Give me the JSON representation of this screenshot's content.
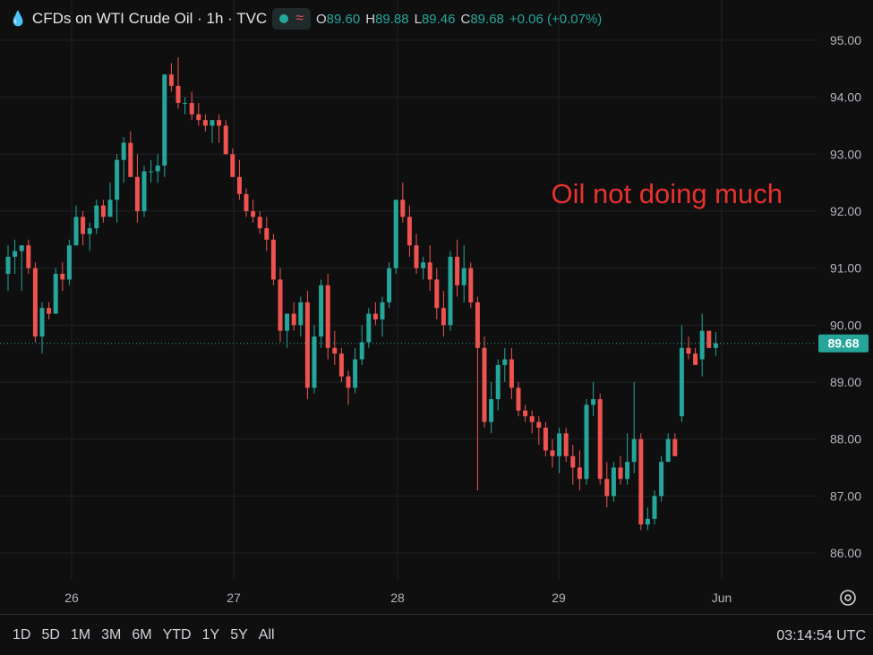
{
  "header": {
    "title": "CFDs on WTI Crude Oil · 1h · TVC",
    "ohlc": [
      {
        "k": "O",
        "v": "89.60"
      },
      {
        "k": "H",
        "v": "89.88"
      },
      {
        "k": "L",
        "v": "89.46"
      },
      {
        "k": "C",
        "v": "89.68"
      },
      {
        "k": "",
        "v": "+0.06 (+0.07%)"
      }
    ]
  },
  "range_buttons": [
    "1D",
    "5D",
    "1M",
    "3M",
    "6M",
    "YTD",
    "1Y",
    "5Y",
    "All"
  ],
  "clock": "03:14:54 UTC",
  "chart_data": {
    "type": "candlestick",
    "annotation": "Oil not doing much",
    "ylim": [
      85.6,
      95.3
    ],
    "y_ticks": [
      "95.00",
      "94.00",
      "93.00",
      "92.00",
      "91.00",
      "90.00",
      "89.00",
      "88.00",
      "87.00",
      "86.00"
    ],
    "x_ticks": [
      {
        "label": "26",
        "x": 3
      },
      {
        "label": "27",
        "x": 27
      },
      {
        "label": "28",
        "x": 51
      },
      {
        "label": "29",
        "x": 75
      },
      {
        "label": "Jun",
        "x": 99
      }
    ],
    "last_price": "89.68",
    "colors": {
      "up": "#26a69a",
      "down": "#ef5350"
    },
    "candles": [
      [
        90.9,
        91.4,
        90.6,
        91.2
      ],
      [
        91.2,
        91.5,
        90.9,
        91.3
      ],
      [
        91.3,
        91.4,
        90.6,
        91.4
      ],
      [
        91.4,
        91.5,
        90.9,
        91.0
      ],
      [
        91.0,
        91.1,
        89.7,
        89.8
      ],
      [
        89.8,
        90.4,
        89.5,
        90.3
      ],
      [
        90.3,
        90.4,
        90.1,
        90.2
      ],
      [
        90.2,
        91.0,
        90.2,
        90.9
      ],
      [
        90.9,
        91.1,
        90.6,
        90.8
      ],
      [
        90.8,
        91.5,
        90.7,
        91.4
      ],
      [
        91.4,
        92.1,
        91.4,
        91.9
      ],
      [
        91.9,
        92.0,
        91.4,
        91.6
      ],
      [
        91.6,
        91.8,
        91.3,
        91.7
      ],
      [
        91.7,
        92.2,
        91.6,
        92.1
      ],
      [
        92.1,
        92.2,
        91.8,
        91.9
      ],
      [
        91.9,
        92.5,
        91.9,
        92.2
      ],
      [
        92.2,
        93.0,
        91.8,
        92.9
      ],
      [
        92.9,
        93.3,
        92.5,
        93.2
      ],
      [
        93.2,
        93.4,
        92.6,
        92.6
      ],
      [
        92.6,
        93.0,
        91.8,
        92.0
      ],
      [
        92.0,
        92.8,
        91.9,
        92.7
      ],
      [
        92.7,
        92.9,
        92.5,
        92.7
      ],
      [
        92.7,
        93.0,
        92.5,
        92.8
      ],
      [
        92.8,
        94.4,
        92.6,
        94.4
      ],
      [
        94.4,
        94.6,
        94.1,
        94.2
      ],
      [
        94.2,
        94.7,
        93.8,
        93.9
      ],
      [
        93.9,
        94.0,
        93.7,
        93.9
      ],
      [
        93.9,
        94.1,
        93.6,
        93.7
      ],
      [
        93.7,
        93.9,
        93.5,
        93.6
      ],
      [
        93.6,
        93.7,
        93.4,
        93.5
      ],
      [
        93.5,
        93.6,
        93.2,
        93.6
      ],
      [
        93.6,
        93.7,
        93.2,
        93.5
      ],
      [
        93.5,
        93.6,
        93.0,
        93.0
      ],
      [
        93.0,
        93.1,
        92.6,
        92.6
      ],
      [
        92.6,
        92.9,
        92.2,
        92.3
      ],
      [
        92.3,
        92.4,
        91.9,
        92.0
      ],
      [
        92.0,
        92.2,
        91.8,
        91.9
      ],
      [
        91.9,
        92.0,
        91.6,
        91.7
      ],
      [
        91.7,
        91.9,
        91.3,
        91.5
      ],
      [
        91.5,
        91.6,
        90.7,
        90.8
      ],
      [
        90.8,
        91.0,
        89.7,
        89.9
      ],
      [
        89.9,
        90.2,
        89.6,
        90.2
      ],
      [
        90.2,
        90.4,
        89.9,
        90.0
      ],
      [
        90.0,
        90.5,
        89.8,
        90.4
      ],
      [
        90.4,
        90.6,
        88.7,
        88.9
      ],
      [
        88.9,
        90.0,
        88.8,
        89.8
      ],
      [
        89.8,
        90.8,
        89.6,
        90.7
      ],
      [
        90.7,
        90.9,
        89.4,
        89.6
      ],
      [
        89.6,
        89.9,
        89.3,
        89.5
      ],
      [
        89.5,
        89.6,
        89.0,
        89.1
      ],
      [
        89.1,
        89.2,
        88.6,
        88.9
      ],
      [
        88.9,
        89.6,
        88.8,
        89.4
      ],
      [
        89.4,
        90.0,
        89.3,
        89.7
      ],
      [
        89.7,
        90.3,
        89.6,
        90.2
      ],
      [
        90.2,
        90.4,
        90.0,
        90.1
      ],
      [
        90.1,
        90.5,
        89.8,
        90.4
      ],
      [
        90.4,
        91.1,
        90.3,
        91.0
      ],
      [
        91.0,
        92.2,
        90.9,
        92.2
      ],
      [
        92.2,
        92.5,
        91.8,
        91.9
      ],
      [
        91.9,
        92.1,
        91.2,
        91.4
      ],
      [
        91.4,
        91.6,
        90.9,
        91.0
      ],
      [
        91.0,
        91.2,
        90.8,
        91.1
      ],
      [
        91.1,
        91.4,
        90.6,
        90.8
      ],
      [
        90.8,
        91.0,
        90.1,
        90.3
      ],
      [
        90.3,
        90.6,
        89.8,
        90.0
      ],
      [
        90.0,
        91.3,
        89.9,
        91.2
      ],
      [
        91.2,
        91.5,
        90.5,
        90.7
      ],
      [
        90.7,
        91.4,
        90.4,
        91.0
      ],
      [
        91.0,
        91.1,
        90.3,
        90.4
      ],
      [
        90.4,
        90.5,
        87.1,
        89.6
      ],
      [
        89.6,
        89.8,
        88.2,
        88.3
      ],
      [
        88.3,
        89.0,
        88.1,
        88.7
      ],
      [
        88.7,
        89.4,
        88.5,
        89.3
      ],
      [
        89.3,
        89.6,
        89.0,
        89.4
      ],
      [
        89.4,
        89.6,
        88.7,
        88.9
      ],
      [
        88.9,
        89.0,
        88.4,
        88.5
      ],
      [
        88.5,
        88.6,
        88.3,
        88.4
      ],
      [
        88.4,
        88.5,
        88.1,
        88.3
      ],
      [
        88.3,
        88.4,
        87.9,
        88.2
      ],
      [
        88.2,
        88.3,
        87.7,
        87.8
      ],
      [
        87.8,
        88.0,
        87.5,
        87.7
      ],
      [
        87.7,
        88.2,
        87.4,
        88.1
      ],
      [
        88.1,
        88.2,
        87.6,
        87.7
      ],
      [
        87.7,
        87.9,
        87.2,
        87.5
      ],
      [
        87.5,
        87.8,
        87.1,
        87.3
      ],
      [
        87.3,
        88.7,
        87.2,
        88.6
      ],
      [
        88.6,
        89.0,
        88.4,
        88.7
      ],
      [
        88.7,
        88.8,
        87.2,
        87.3
      ],
      [
        87.3,
        87.6,
        86.8,
        87.0
      ],
      [
        87.0,
        87.6,
        86.9,
        87.5
      ],
      [
        87.5,
        87.7,
        87.2,
        87.3
      ],
      [
        87.3,
        88.1,
        87.2,
        87.6
      ],
      [
        87.6,
        89.0,
        87.4,
        88.0
      ],
      [
        88.0,
        88.1,
        86.4,
        86.5
      ],
      [
        86.5,
        86.8,
        86.4,
        86.6
      ],
      [
        86.6,
        87.1,
        86.5,
        87.0
      ],
      [
        87.0,
        87.7,
        86.9,
        87.6
      ],
      [
        87.6,
        88.1,
        87.6,
        88.0
      ],
      [
        88.0,
        88.1,
        87.7,
        87.7
      ],
      [
        88.4,
        90.0,
        88.3,
        89.6
      ],
      [
        89.6,
        89.8,
        89.4,
        89.5
      ],
      [
        89.5,
        89.6,
        89.3,
        89.3
      ],
      [
        89.4,
        90.2,
        89.1,
        89.9
      ],
      [
        89.9,
        89.9,
        89.6,
        89.6
      ],
      [
        89.6,
        89.88,
        89.46,
        89.68
      ]
    ]
  }
}
